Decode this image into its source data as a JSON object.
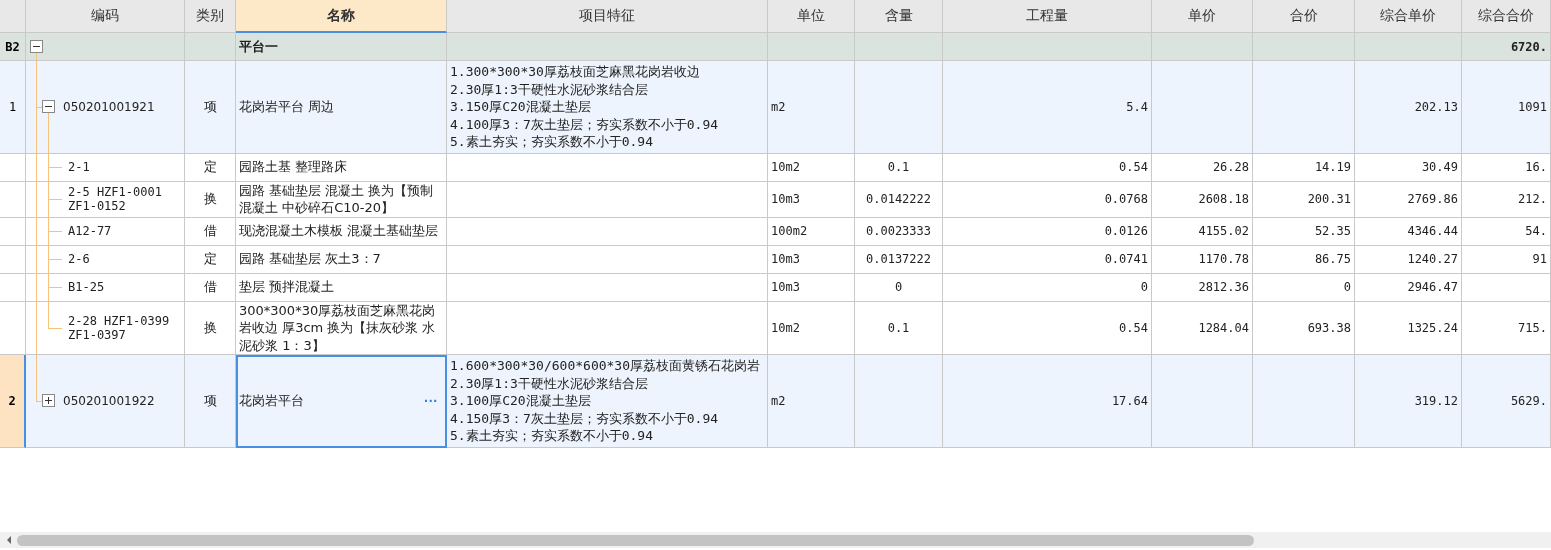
{
  "columns": [
    {
      "label": "编码",
      "selected": false
    },
    {
      "label": "类别",
      "selected": false
    },
    {
      "label": "名称",
      "selected": true
    },
    {
      "label": "项目特征",
      "selected": false
    },
    {
      "label": "单位",
      "selected": false
    },
    {
      "label": "含量",
      "selected": false
    },
    {
      "label": "工程量",
      "selected": false
    },
    {
      "label": "单价",
      "selected": false
    },
    {
      "label": "合价",
      "selected": false
    },
    {
      "label": "综合单价",
      "selected": false
    },
    {
      "label": "综合合价",
      "selected": false
    }
  ],
  "sections": [
    {
      "index": "B2",
      "name": "平台一",
      "comp_total": "6720.",
      "expanded": true,
      "children": [
        {
          "index": "1",
          "code": "050201001921",
          "type": "项",
          "name": "花岗岩平台 周边",
          "features": [
            "1.300*300*30厚荔枝面芝麻黑花岗岩收边",
            "2.30厚1:3干硬性水泥砂浆结合层",
            "3.150厚C20混凝土垫层",
            "4.100厚3：7灰土垫层；夯实系数不小于0.94",
            "5.素土夯实；夯实系数不小于0.94"
          ],
          "unit": "m2",
          "quantity": "5.4",
          "comp_unit_price": "202.13",
          "comp_total": "1091",
          "expanded": true,
          "selected": false,
          "children": [
            {
              "code": "2-1",
              "type": "定",
              "name": "园路土基 整理路床",
              "unit": "10m2",
              "content": "0.1",
              "quantity": "0.54",
              "unit_price": "26.28",
              "total_price": "14.19",
              "comp_unit_price": "30.49",
              "comp_total": "16."
            },
            {
              "code": "2-5 HZF1-0001 ZF1-0152",
              "type": "换",
              "name": "园路 基础垫层 混凝土  换为【预制混凝土 中砂碎石C10-20】",
              "unit": "10m3",
              "content": "0.0142222",
              "quantity": "0.0768",
              "unit_price": "2608.18",
              "total_price": "200.31",
              "comp_unit_price": "2769.86",
              "comp_total": "212."
            },
            {
              "code": "A12-77",
              "type": "借",
              "name": "现浇混凝土木模板 混凝土基础垫层",
              "unit": "100m2",
              "content": "0.0023333",
              "quantity": "0.0126",
              "unit_price": "4155.02",
              "total_price": "52.35",
              "comp_unit_price": "4346.44",
              "comp_total": "54."
            },
            {
              "code": "2-6",
              "type": "定",
              "name": "园路 基础垫层 灰土3：7",
              "unit": "10m3",
              "content": "0.0137222",
              "quantity": "0.0741",
              "unit_price": "1170.78",
              "total_price": "86.75",
              "comp_unit_price": "1240.27",
              "comp_total": "91"
            },
            {
              "code": "B1-25",
              "type": "借",
              "name": "垫层 预拌混凝土",
              "unit": "10m3",
              "content": "0",
              "quantity": "0",
              "unit_price": "2812.36",
              "total_price": "0",
              "comp_unit_price": "2946.47"
            },
            {
              "code": "2-28 HZF1-0399 ZF1-0397",
              "type": "换",
              "name": "300*300*30厚荔枝面芝麻黑花岗岩收边 厚3cm  换为【抹灰砂浆 水泥砂浆 1：3】",
              "unit": "10m2",
              "content": "0.1",
              "quantity": "0.54",
              "unit_price": "1284.04",
              "total_price": "693.38",
              "comp_unit_price": "1325.24",
              "comp_total": "715."
            }
          ]
        },
        {
          "index": "2",
          "code": "050201001922",
          "type": "项",
          "name": "花岗岩平台",
          "edit_button": "···",
          "features": [
            "1.600*300*30/600*600*30厚荔枝面黄锈石花岗岩",
            "2.30厚1:3干硬性水泥砂浆结合层",
            "3.100厚C20混凝土垫层",
            "4.150厚3：7灰土垫层；夯实系数不小于0.94",
            "5.素土夯实；夯实系数不小于0.94"
          ],
          "unit": "m2",
          "quantity": "17.64",
          "comp_unit_price": "319.12",
          "comp_total": "5629.",
          "expanded": false,
          "selected": true
        }
      ]
    }
  ]
}
